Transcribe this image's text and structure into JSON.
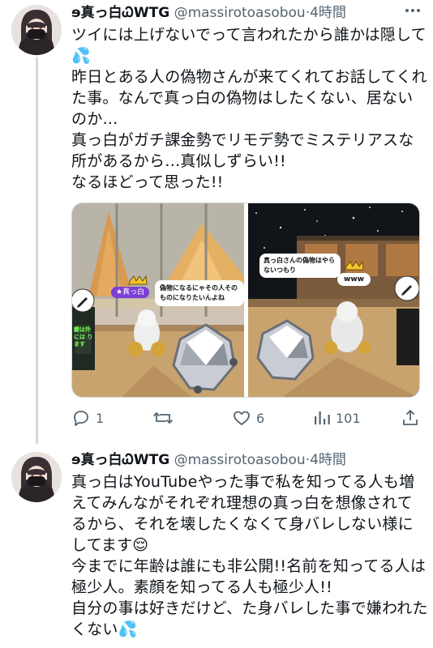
{
  "tweets": [
    {
      "display_name": "ɘ真っ白ᏇWTG",
      "handle": "@massirotoasobou",
      "separator": "·",
      "time": "4時間",
      "text": "ツイには上げないでって言われたから誰かは隠して💦\n昨日とある人の偽物さんが来てくれてお話してくれた事。なんで真っ白の偽物はしたくない、居ないのか…\n真っ白がガチ課金勢でリモデ勢でミステリアスな所があるから…真似しずらい!!\nなるほどって思った!!",
      "media": {
        "left_tag": "★真っ白",
        "left_speech": "偽物になるにゃその人そのものになりたいんよね",
        "left_sign": "鍵は外には ります",
        "right_speech": "真っ白さんの偽物はやらないつもり",
        "right_tag": "www"
      },
      "actions": {
        "reply_count": "1",
        "retweet_count": "",
        "like_count": "6",
        "views_count": "101"
      }
    },
    {
      "display_name": "ɘ真っ白ᏇWTG",
      "handle": "@massirotoasobou",
      "separator": "·",
      "time": "4時間",
      "text": "真っ白はYouTubeやった事で私を知ってる人も増えてみんながそれぞれ理想の真っ白を想像されてるから、それを壊したくなくて身バレしない様にしてます😌\n今までに年齢は誰にも非公開!!名前を知ってる人は極少人。素顔を知ってる人も極少人!!\n自分の事は好きだけど、た身バレした事で嫌われたくない💦"
    }
  ],
  "colors": {
    "text": "#0f1419",
    "secondary": "#536471",
    "thread_line": "#cfd9de"
  },
  "icons": [
    "more-icon",
    "reply-icon",
    "retweet-icon",
    "like-icon",
    "views-icon",
    "share-icon"
  ]
}
